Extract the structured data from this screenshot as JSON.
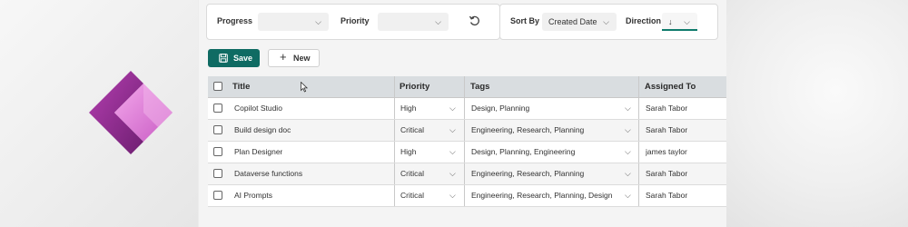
{
  "filters": {
    "progress_label": "Progress",
    "progress_value": "",
    "priority_label": "Priority",
    "priority_value": "",
    "sort_by_label": "Sort By",
    "sort_by_value": "Created Date",
    "direction_label": "Direction",
    "direction_value": "↓"
  },
  "toolbar": {
    "save_label": "Save",
    "new_label": "New"
  },
  "grid": {
    "columns": [
      "Title",
      "Priority",
      "Tags",
      "Assigned To"
    ],
    "rows": [
      {
        "title": "Copilot Studio",
        "priority": "High",
        "tags": "Design, Planning",
        "assigned": "Sarah Tabor"
      },
      {
        "title": "Build design doc",
        "priority": "Critical",
        "tags": "Engineering, Research, Planning",
        "assigned": "Sarah Tabor"
      },
      {
        "title": "Plan Designer",
        "priority": "High",
        "tags": "Design, Planning, Engineering",
        "assigned": "james taylor"
      },
      {
        "title": "Dataverse functions",
        "priority": "Critical",
        "tags": "Engineering, Research, Planning",
        "assigned": "Sarah Tabor"
      },
      {
        "title": "AI Prompts",
        "priority": "Critical",
        "tags": "Engineering, Research, Planning, Design",
        "assigned": "Sarah Tabor"
      }
    ]
  },
  "colors": {
    "accent": "#0f6b63",
    "logo_dark": "#742774",
    "logo_light": "#e08ad6"
  },
  "icons": {
    "logo": "power-apps-logo-icon",
    "refresh": "refresh-icon",
    "save": "save-icon",
    "new": "plus-icon",
    "dropdown": "chevron-down-icon"
  }
}
